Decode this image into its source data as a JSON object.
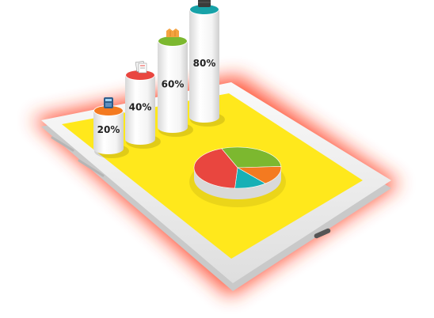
{
  "illustration": {
    "subject": "tablet-with-3d-infographic",
    "colors": {
      "glow": "#ff3b1f",
      "tablet_body": "#f1f1f1",
      "tablet_edge": "#c9c9c9",
      "screen": "#ffe81c",
      "cylinder_side": "#ffffff",
      "cylinder_shade": "#dcdcdc"
    }
  },
  "cylinders": [
    {
      "label": "20%",
      "value": 20,
      "cap_color": "#f47a20",
      "icon": "calculator-icon"
    },
    {
      "label": "40%",
      "value": 40,
      "cap_color": "#e9463f",
      "icon": "documents-icon"
    },
    {
      "label": "60%",
      "value": 60,
      "cap_color": "#7cb82f",
      "icon": "stacked-hands-icon"
    },
    {
      "label": "80%",
      "value": 80,
      "cap_color": "#17a2a8",
      "icon": "briefcase-icon"
    }
  ],
  "pie": {
    "slices": [
      {
        "color": "#7cb82f",
        "share": 0.3
      },
      {
        "color": "#f47a20",
        "share": 0.15
      },
      {
        "color": "#17b0b5",
        "share": 0.12
      },
      {
        "color": "#e9463f",
        "share": 0.43
      }
    ]
  }
}
